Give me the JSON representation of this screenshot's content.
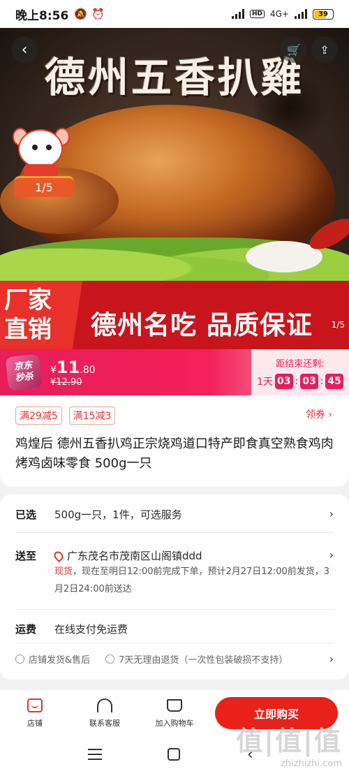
{
  "status_bar": {
    "time": "晚上8:56",
    "network": "4G+",
    "battery": "39"
  },
  "hero": {
    "title": "德州五香扒雞",
    "image_counter": "1/5",
    "side_index": "1/5",
    "banner_left_line1": "厂家",
    "banner_left_line2": "直销",
    "banner_text": "德州名吃 品质保证",
    "back_icon": "chevron-left-icon",
    "cart_icon": "cart-icon",
    "share_icon": "share-icon"
  },
  "price_bar": {
    "badge_line1": "京东",
    "badge_line2": "秒杀",
    "currency": "¥",
    "price_int": "11",
    "price_dec": ".80",
    "original_price": "¥12.90",
    "countdown_label": "距结束还剩:",
    "days": "1天",
    "hh": "03",
    "mm": "03",
    "ss": "45",
    "accent": "#e61e5a"
  },
  "promo": {
    "tags": [
      "满29减5",
      "满15减3"
    ],
    "coupon": "领券 ›"
  },
  "product": {
    "title": "鸡煌后 德州五香扒鸡正宗烧鸡道口特产即食真空熟食鸡肉烤鸡卤味零食 500g一只"
  },
  "details": {
    "selected_label": "已选",
    "selected_value": "500g一只，1件，可选服务",
    "ship_label": "送至",
    "ship_value": "广东茂名市茂南区山阁镇ddd",
    "stock": "现货",
    "delivery_text": "，现在至明日12:00前完成下单，预计2月27日12:00前发货，3月2日24:00前送达",
    "fee_label": "运费",
    "fee_value": "在线支付免运费",
    "service1": "店铺发货&售后",
    "service2": "7天无理由退货（一次性包装破损不支持）"
  },
  "action_bar": {
    "shop": "店铺",
    "service": "联系客服",
    "cart": "加入购物车",
    "buy": "立即购买"
  },
  "watermark": {
    "main": "值|值|值",
    "site": "zhizhizhi.com"
  }
}
